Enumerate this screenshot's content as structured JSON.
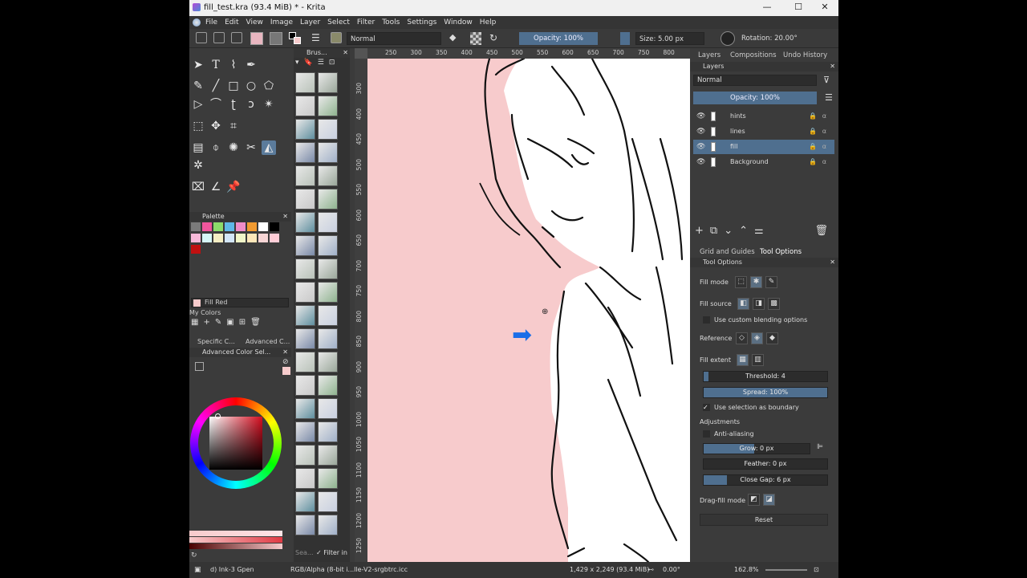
{
  "window": {
    "title": "fill_test.kra (93.4 MiB) * - Krita",
    "minimize": "—",
    "maximize": "☐",
    "close": "✕"
  },
  "menu": [
    "File",
    "Edit",
    "View",
    "Image",
    "Layer",
    "Select",
    "Filter",
    "Tools",
    "Settings",
    "Window",
    "Help"
  ],
  "toolbar": {
    "blend_mode": "Normal",
    "opacity": "Opacity: 100%",
    "size": "Size: 5.00 px",
    "rotation": "Rotation: 20.00°"
  },
  "docks": {
    "brushes_title": "Brus...",
    "palette_title": "Palette",
    "current_color_name": "Fill Red",
    "my_colors": "My Colors",
    "specific_tab": "Specific C...",
    "advanced_tab": "Advanced C...",
    "advanced_title": "Advanced Color Sel...",
    "brush_search_placeholder": "Sea...",
    "filter_in": "Filter in"
  },
  "palette_colors": [
    "#7a7a7a",
    "#f0569d",
    "#8cdc6a",
    "#5fb8e8",
    "#f08cc8",
    "#f09a30",
    "#ffffff",
    "#000000",
    "#f7b9d9",
    "#d6f7f7",
    "#f4eec3",
    "#d3e6f7",
    "#f1f6c8",
    "#fde7b9",
    "#f7d5d5",
    "#ffcdd7",
    "#c01010"
  ],
  "rulers": {
    "h": [
      "250",
      "300",
      "350",
      "400",
      "450",
      "500",
      "550",
      "600",
      "650",
      "700",
      "750",
      "800"
    ],
    "v": [
      "300",
      "400",
      "450",
      "500",
      "550",
      "600",
      "650",
      "700",
      "750",
      "800",
      "850",
      "900",
      "950",
      "1000",
      "1050",
      "1100",
      "1150",
      "1200",
      "1250"
    ]
  },
  "right_tabs": {
    "layers": "Layers",
    "compositions": "Compositions",
    "undo": "Undo History"
  },
  "layers_dock": {
    "title": "Layers",
    "blend": "Normal",
    "opacity": "Opacity: 100%",
    "items": [
      {
        "name": "hints",
        "selected": false
      },
      {
        "name": "lines",
        "selected": false
      },
      {
        "name": "fill",
        "selected": true
      },
      {
        "name": "Background",
        "selected": false
      }
    ]
  },
  "lower_tabs": {
    "grid": "Grid and Guides",
    "tool_options": "Tool Options"
  },
  "tool_options": {
    "title": "Tool Options",
    "fill_mode": "Fill mode",
    "fill_source": "Fill source",
    "custom_blend": "Use custom blending options",
    "reference": "Reference",
    "fill_extent": "Fill extent",
    "threshold": "Threshold: 4",
    "threshold_value": 4,
    "spread": "Spread: 100%",
    "spread_value": 100,
    "use_selection": "Use selection as boundary",
    "adjustments": "Adjustments",
    "anti_aliasing": "Anti-aliasing",
    "grow": "Grow: 0 px",
    "feather": "Feather: 0 px",
    "close_gap": "Close Gap: 6 px",
    "close_gap_value": 6,
    "drag_fill": "Drag-fill mode",
    "reset": "Reset"
  },
  "status": {
    "brush": "d) Ink-3 Gpen",
    "color_profile": "RGB/Alpha (8-bit i...lle-V2-srgbtrc.icc",
    "size_info": "1,429 x 2,249 (93.4 MiB)",
    "rotation": "0.00°",
    "zoom": "162.8%"
  },
  "colors": {
    "accent": "#4f6f8f",
    "canvas_fill": "#f7cbcc",
    "arrow": "#1a6ee8",
    "bg": "#3b3b3b"
  }
}
